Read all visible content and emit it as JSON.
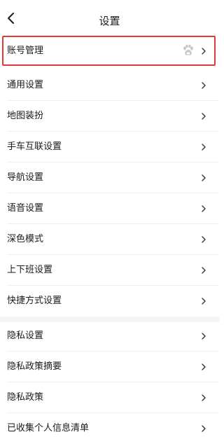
{
  "header": {
    "title": "设置"
  },
  "account": {
    "label": "账号管理",
    "icon": "baidu-paw-icon"
  },
  "items": [
    {
      "label": "通用设置"
    },
    {
      "label": "地图装扮"
    },
    {
      "label": "手车互联设置"
    },
    {
      "label": "导航设置"
    },
    {
      "label": "语音设置"
    },
    {
      "label": "深色模式"
    },
    {
      "label": "上下班设置"
    },
    {
      "label": "快捷方式设置"
    }
  ],
  "privacy_items": [
    {
      "label": "隐私设置"
    },
    {
      "label": "隐私政策摘要"
    },
    {
      "label": "隐私政策"
    },
    {
      "label": "已收集个人信息清单"
    }
  ],
  "colors": {
    "highlight_border": "#e53935",
    "text": "#1a1a1a",
    "chevron": "#333333",
    "icon_gray": "#c8c8c8"
  }
}
